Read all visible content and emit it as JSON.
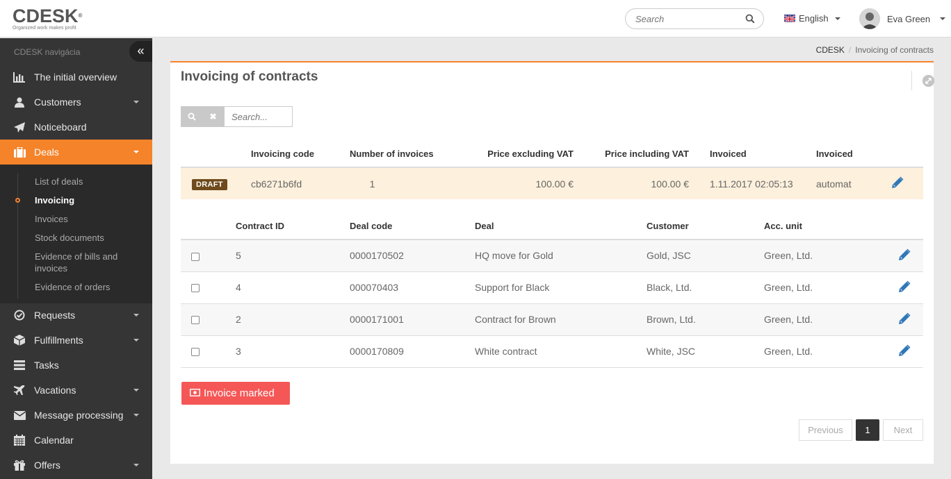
{
  "header": {
    "logo_text": "CDESK",
    "logo_reg": "®",
    "tagline": "Organized work makes profit",
    "search_placeholder": "Search",
    "language": "English",
    "user_name": "Eva Green"
  },
  "sidebar": {
    "title": "CDESK navigácia",
    "collapse_glyph": "«",
    "items": [
      {
        "label": "The initial overview"
      },
      {
        "label": "Customers"
      },
      {
        "label": "Noticeboard"
      },
      {
        "label": "Deals"
      },
      {
        "label": "Requests"
      },
      {
        "label": "Fulfillments"
      },
      {
        "label": "Tasks"
      },
      {
        "label": "Vacations"
      },
      {
        "label": "Message processing"
      },
      {
        "label": "Calendar"
      },
      {
        "label": "Offers"
      }
    ],
    "sub_items": [
      {
        "label": "List of deals"
      },
      {
        "label": "Invoicing"
      },
      {
        "label": "Invoices"
      },
      {
        "label": "Stock documents"
      },
      {
        "label": "Evidence of bills and invoices"
      },
      {
        "label": "Evidence of orders"
      }
    ]
  },
  "breadcrumb": {
    "root": "CDESK",
    "separator": "/",
    "current": "Invoicing of contracts"
  },
  "panel": {
    "title": "Invoicing of contracts",
    "search_placeholder": "Search...",
    "clear_glyph": "✖"
  },
  "invoice_table": {
    "headers": [
      "Invoicing code",
      "Number of invoices",
      "Price excluding VAT",
      "Price including VAT",
      "Invoiced",
      "Invoiced"
    ],
    "row": {
      "status": "DRAFT",
      "code": "cb6271b6fd",
      "count": "1",
      "price_ex_vat": "100.00 €",
      "price_inc_vat": "100.00 €",
      "invoiced_date": "1.11.2017 02:05:13",
      "invoiced_by": "automat"
    }
  },
  "contracts_table": {
    "headers": [
      "Contract ID",
      "Deal code",
      "Deal",
      "Customer",
      "Acc. unit"
    ],
    "rows": [
      {
        "id": "5",
        "deal_code": "0000170502",
        "deal": "HQ move for Gold",
        "customer": "Gold, JSC",
        "acc_unit": "Green, Ltd."
      },
      {
        "id": "4",
        "deal_code": "000070403",
        "deal": "Support for Black",
        "customer": "Black, Ltd.",
        "acc_unit": "Green, Ltd."
      },
      {
        "id": "2",
        "deal_code": "0000171001",
        "deal": "Contract for Brown",
        "customer": "Brown, Ltd.",
        "acc_unit": "Green, Ltd."
      },
      {
        "id": "3",
        "deal_code": "0000170809",
        "deal": "White contract",
        "customer": "White, JSC",
        "acc_unit": "Green, Ltd."
      }
    ]
  },
  "actions": {
    "invoice_marked": "Invoice marked"
  },
  "pagination": {
    "previous": "Previous",
    "page": "1",
    "next": "Next"
  },
  "colors": {
    "accent": "#f5832a",
    "sidebar_bg": "#353535",
    "draft_badge": "#6e4a1c",
    "danger_button": "#f55757",
    "edit_icon": "#2f78b8"
  }
}
